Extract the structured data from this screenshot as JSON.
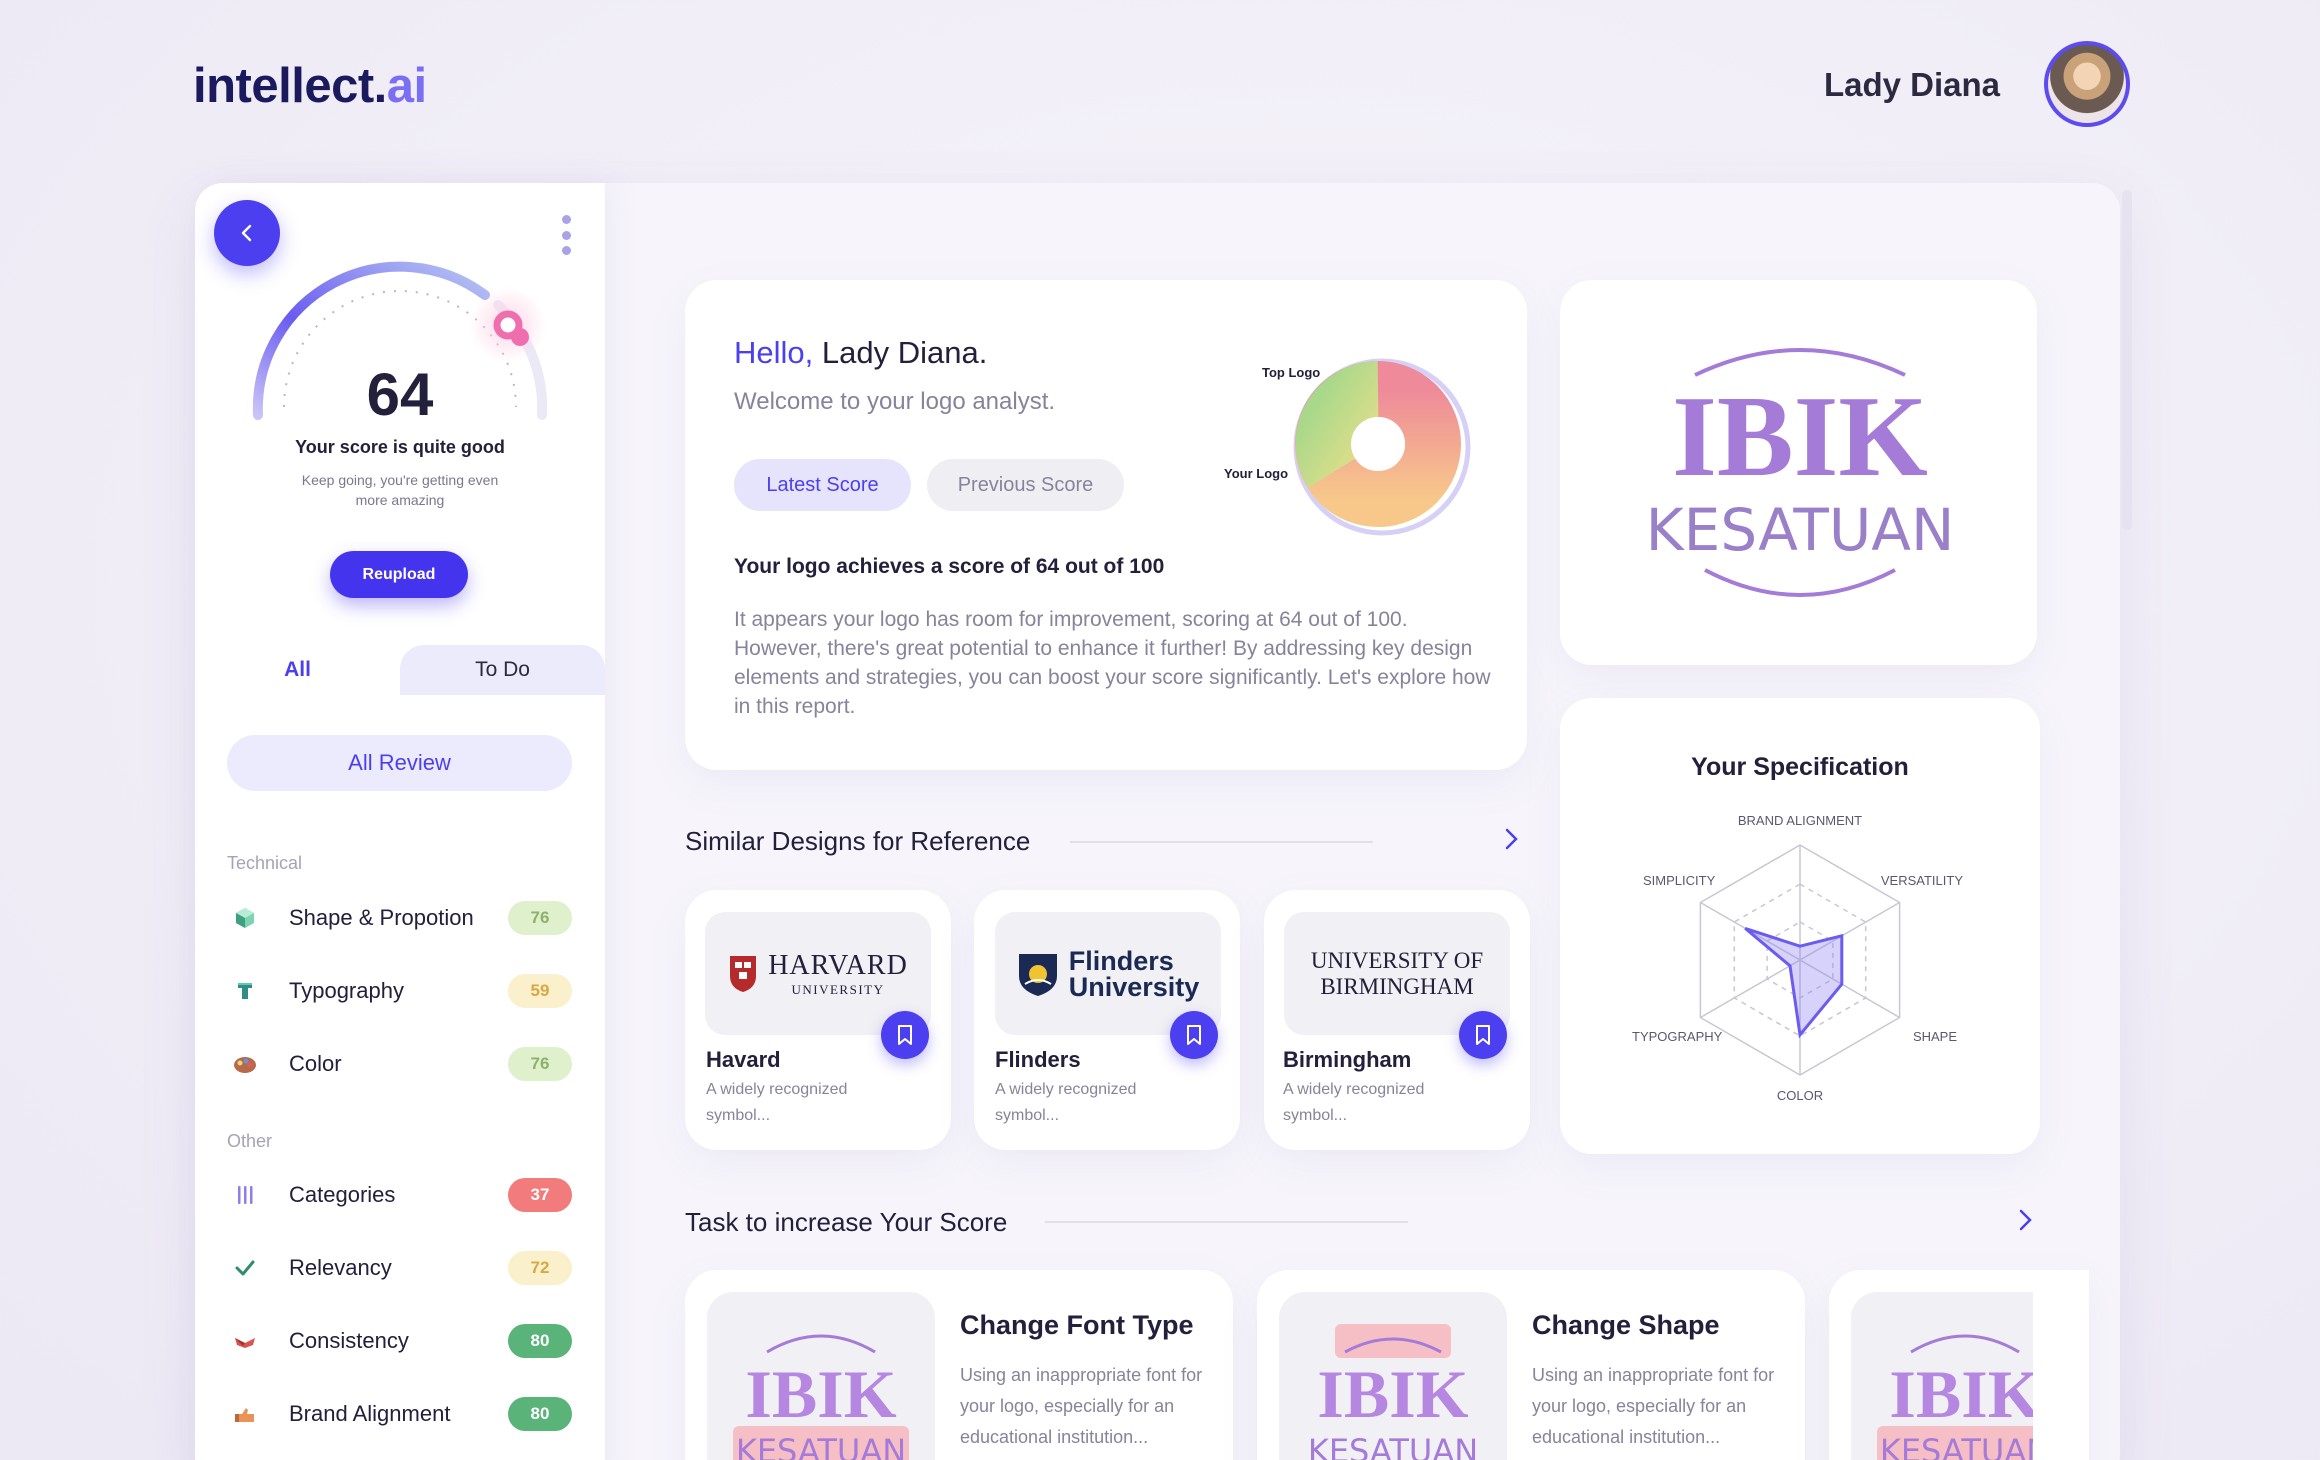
{
  "header": {
    "brand_main": "intellect.",
    "brand_accent": "ai",
    "user_name": "Lady Diana"
  },
  "sidebar": {
    "score": "64",
    "score_max": 100,
    "score_title": "Your score is quite good",
    "score_sub": "Keep going, you're getting even more amazing",
    "reupload_label": "Reupload",
    "tabs": [
      "All",
      "To Do"
    ],
    "all_review_label": "All Review",
    "sections": [
      {
        "label": "Technical",
        "items": [
          {
            "label": "Shape & Propotion",
            "score": "76",
            "icon": "cube-icon",
            "badge": "green"
          },
          {
            "label": "Typography",
            "score": "59",
            "icon": "font-icon",
            "badge": "yellow"
          },
          {
            "label": "Color",
            "score": "76",
            "icon": "palette-icon",
            "badge": "green"
          }
        ]
      },
      {
        "label": "Other",
        "items": [
          {
            "label": "Categories",
            "score": "37",
            "icon": "bars-icon",
            "badge": "red"
          },
          {
            "label": "Relevancy",
            "score": "72",
            "icon": "check-icon",
            "badge": "yellow"
          },
          {
            "label": "Consistency",
            "score": "80",
            "icon": "arrows-icon",
            "badge": "dgreen"
          },
          {
            "label": "Brand Alignment",
            "score": "80",
            "icon": "hand-icon",
            "badge": "dgreen"
          }
        ]
      }
    ]
  },
  "hello": {
    "greeting": "Hello,",
    "name": "Lady Diana.",
    "welcome": "Welcome to your logo analyst.",
    "btn_latest": "Latest Score",
    "btn_previous": "Previous Score",
    "achieves": "Your logo achieves a score of 64 out of 100",
    "description": "It appears your logo has room for improvement, scoring at 64 out of 100. However, there's great potential to enhance it further! By addressing key design elements and strategies, you can boost your score significantly. Let's explore how in this report.",
    "donut_label_top": "Top Logo",
    "donut_label_your": "Your Logo"
  },
  "brand_logo": {
    "line1": "IBIK",
    "line2": "KESATUAN",
    "color": "#a57bd8"
  },
  "spec": {
    "title": "Your Specification",
    "axes": [
      "BRAND ALIGNMENT",
      "VERSATILITY",
      "SHAPE",
      "COLOR",
      "TYPOGRAPHY",
      "SIMPLICITY"
    ],
    "values": [
      0.12,
      0.42,
      0.42,
      0.65,
      0.1,
      0.55
    ]
  },
  "similar": {
    "title": "Similar Designs for Reference",
    "items": [
      {
        "logo_text": "HARVARD",
        "logo_sub": "UNIVERSITY",
        "name": "Havard",
        "desc": "A widely recognized symbol..."
      },
      {
        "logo_text": "Flinders",
        "logo_sub": "University",
        "name": "Flinders",
        "desc": "A widely recognized symbol..."
      },
      {
        "logo_text": "UNIVERSITY OF",
        "logo_sub": "BIRMINGHAM",
        "name": "Birmingham",
        "desc": "A widely recognized symbol..."
      }
    ]
  },
  "tasks": {
    "title": "Task to increase Your Score",
    "items": [
      {
        "title": "Change Font Type",
        "desc": "Using an inappropriate font for your logo, especially for an educational institution..."
      },
      {
        "title": "Change Shape",
        "desc": "Using an inappropriate font for your logo, especially for an educational institution..."
      }
    ]
  },
  "colors": {
    "accent": "#4c3ff0",
    "badge_green": "#dff0cc",
    "badge_yellow": "#fbf0cc",
    "badge_red": "#f27b7b",
    "badge_dgreen": "#5ab47a"
  }
}
